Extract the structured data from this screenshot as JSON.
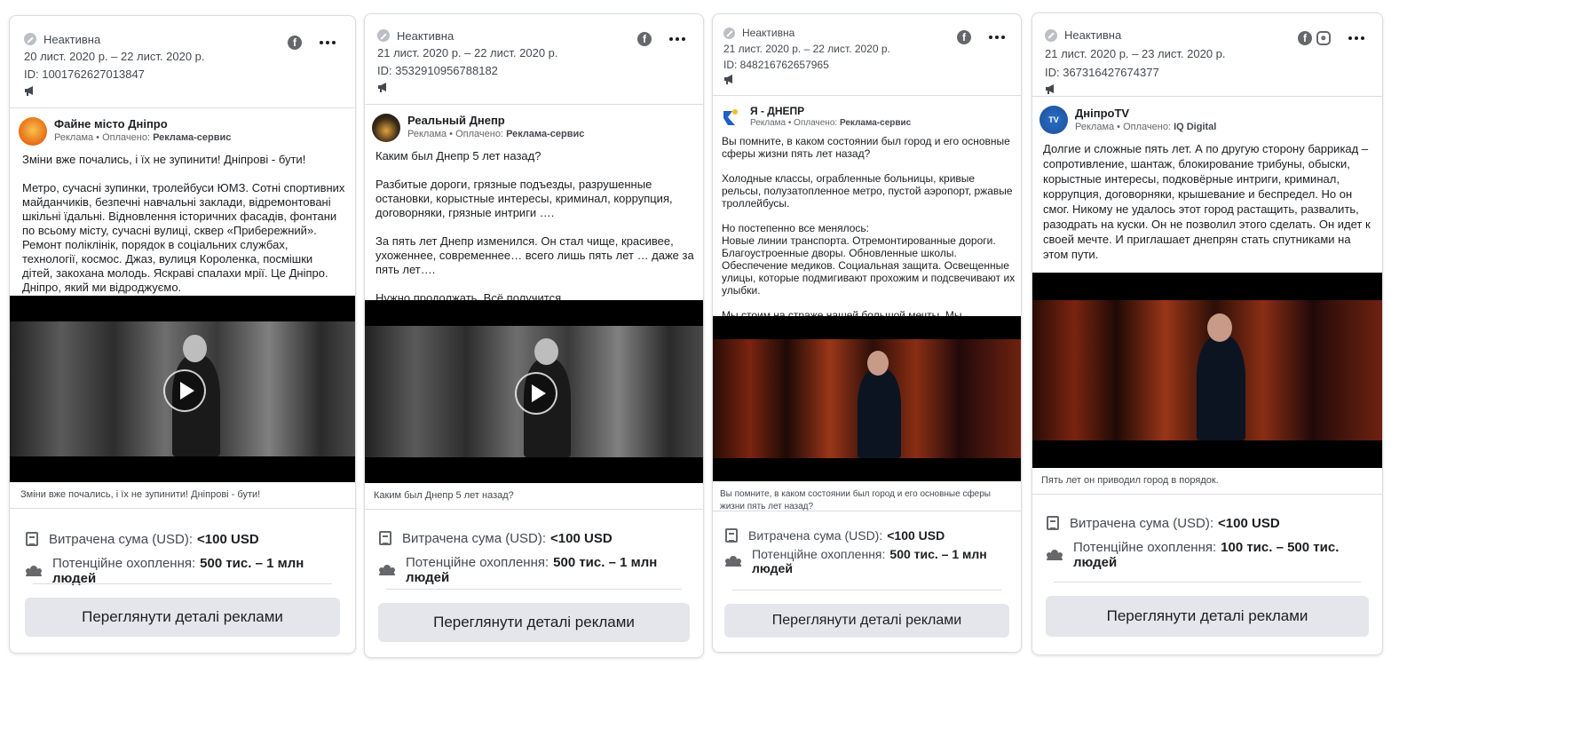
{
  "common": {
    "status": "Неактивна",
    "spent_label": "Витрачена сума (USD):",
    "reach_label": "Потенційне охоплення:",
    "details_button": "Переглянути деталі реклами",
    "sponsored": "Реклама • Оплачено: "
  },
  "cards": [
    {
      "dates": "20 лист. 2020 р. – 22 лист. 2020 р.",
      "id": "ID: 1001762627013847",
      "platforms": [
        "facebook-icon"
      ],
      "advertiser": "Файне місто Дніпро",
      "paid_by": "Реклама-сервис",
      "body": "Зміни вже почались, і їх не зупинити! Дніпрові - бути!\n\nМетро, сучасні зупинки, тролейбуси ЮМЗ. Сотні спортивних майданчиків, безпечні навчальні заклади, відремонтовані шкільні їдальні. Відновлення історичних фасадів, фонтани по всьому місту, сучасні вулиці, сквер «Прибережний». Ремонт поліклінік, порядок в соціальних службах, технології, космос. Джаз, вулиця Короленка, посмішки дітей, закохана молодь. Яскраві спалахи мрії. Це Дніпро. Дніпро, який ми відроджуємо.",
      "caption": "Зміни вже почались, і їх не зупинити! Дніпрові - бути!",
      "spent": "<100 USD",
      "reach": "500 тис. – 1 млн людей"
    },
    {
      "dates": "21 лист. 2020 р. – 22 лист. 2020 р.",
      "id": "ID: 3532910956788182",
      "platforms": [
        "facebook-icon"
      ],
      "advertiser": "Реальный Днепр",
      "paid_by": "Реклама-сервис",
      "body": "Каким был Днепр 5 лет назад?\n\nРазбитые дороги, грязные подъезды, разрушенные остановки, корыстные интересы, криминал, коррупция, договорняки, грязные интриги ….\n\nЗа пять лет Днепр изменился. Он стал чище, красивее, ухоженнее, современнее… всего лишь пять лет … даже за пять лет….\n\nНужно продолжать. Всё получится.",
      "caption": "Каким был Днепр 5 лет назад?",
      "spent": "<100 USD",
      "reach": "500 тис. – 1 млн людей"
    },
    {
      "dates": "21 лист. 2020 р. – 22 лист. 2020 р.",
      "id": "ID: 848216762657965",
      "platforms": [
        "facebook-icon"
      ],
      "advertiser": "Я - ДНЕПР",
      "paid_by": "Реклама-сервис",
      "body": "Вы помните, в каком состоянии был город и его основные сферы жизни пять лет назад?\n\nХолодные классы, ограбленные больницы, кривые рельсы, полузатопленное метро, пустой аэропорт, ржавые троллейбусы.\n\nНо постепенно все менялось:\nНовые линии транспорта. Отремонтированные дороги. Благоустроенные дворы. Обновленные школы. Обеспечение медиков. Социальная защита. Освещенные улицы, которые подмигивают прохожим и подсвечивают их улыбки.\n\nМы стоим на страже нашей большой мечты. Мы защищаем свою мечту. Днепру – быть!",
      "caption": "Вы помните, в каком состоянии был город и его основные сферы жизни пять лет назад?",
      "spent": "<100 USD",
      "reach": "500 тис. – 1 млн людей"
    },
    {
      "dates": "21 лист. 2020 р. – 23 лист. 2020 р.",
      "id": "ID: 367316427674377",
      "platforms": [
        "facebook-icon",
        "instagram-icon"
      ],
      "advertiser": "ДніпроTV",
      "avatar_text": "TV",
      "paid_by": "IQ Digital",
      "body": "Долгие и сложные пять лет. А по другую сторону баррикад – сопротивление, шантаж, блокирование трибуны, обыски, корыстные интересы, подковёрные интриги, криминал, коррупция, договорняки, крышевание и беспредел. Но он смог. Никому не удалось этот город растащить, развалить, разодрать на куски. Он не позволил этого сделать. Он идет к своей мечте. И приглашает днепрян стать спутниками на этом пути.",
      "caption": "Пять лет он приводил город в порядок.",
      "spent": "<100 USD",
      "reach": "100 тис. – 500 тис. людей"
    }
  ],
  "colors": {
    "bw_scene": "#6a6a6a",
    "warm_scene": "#8a2e1a",
    "button_bg": "#e4e6eb",
    "border": "#dadde1"
  }
}
